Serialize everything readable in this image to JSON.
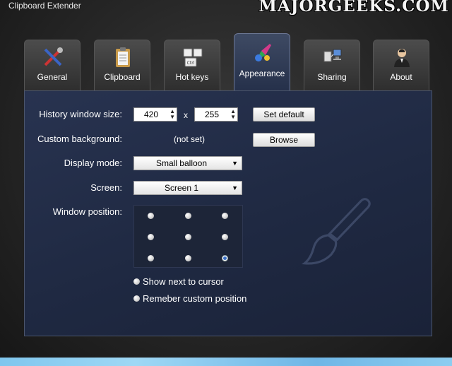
{
  "window": {
    "title": "Clipboard Extender",
    "watermark": "MAJORGEEKS.COM"
  },
  "tabs": [
    {
      "label": "General",
      "icon": "tools-icon",
      "active": false
    },
    {
      "label": "Clipboard",
      "icon": "clipboard-icon",
      "active": false
    },
    {
      "label": "Hot keys",
      "icon": "keyboard-keys-icon",
      "active": false
    },
    {
      "label": "Appearance",
      "icon": "paint-brush-icon",
      "active": true
    },
    {
      "label": "Sharing",
      "icon": "network-computers-icon",
      "active": false
    },
    {
      "label": "About",
      "icon": "user-icon",
      "active": false
    }
  ],
  "appearance": {
    "history_size": {
      "label": "History window size:",
      "width": "420",
      "height": "255",
      "separator": "x",
      "set_default_label": "Set default"
    },
    "background": {
      "label": "Custom background:",
      "value": "(not set)",
      "browse_label": "Browse"
    },
    "display_mode": {
      "label": "Display mode:",
      "selected": "Small balloon"
    },
    "screen": {
      "label": "Screen:",
      "selected": "Screen 1"
    },
    "window_position": {
      "label": "Window position:",
      "selected_index": 8
    },
    "options": {
      "show_next_to_cursor": "Show next to cursor",
      "remember_custom_position": "Remeber custom position"
    }
  },
  "colors": {
    "panel": "#232d47",
    "accent_bar": "#8ccdf0"
  }
}
